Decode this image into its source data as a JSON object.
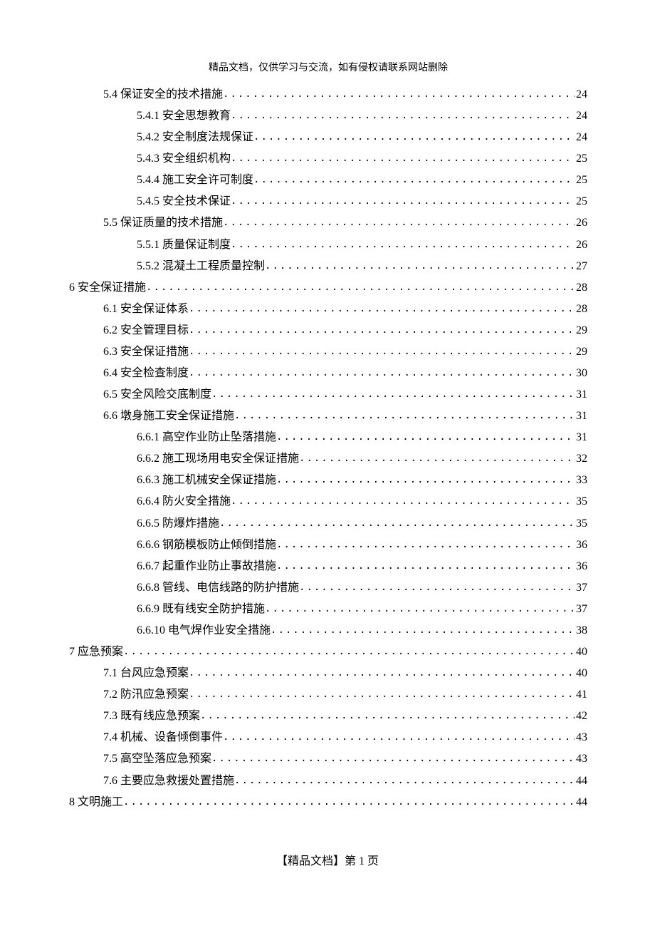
{
  "header_note": "精品文档，仅供学习与交流，如有侵权请联系网站删除",
  "toc": [
    {
      "indent": 1,
      "label": "5.4 保证安全的技术措施 ",
      "page": "24"
    },
    {
      "indent": 2,
      "label": "5.4.1 安全思想教育",
      "page": "24"
    },
    {
      "indent": 2,
      "label": "5.4.2 安全制度法规保证 ",
      "page": "24"
    },
    {
      "indent": 2,
      "label": "5.4.3 安全组织机构 ",
      "page": "25"
    },
    {
      "indent": 2,
      "label": "5.4.4 施工安全许可制度 ",
      "page": "25"
    },
    {
      "indent": 2,
      "label": "5.4.5 安全技术保证 ",
      "page": "25"
    },
    {
      "indent": 1,
      "label": "5.5 保证质量的技术措施",
      "page": "26"
    },
    {
      "indent": 2,
      "label": "5.5.1 质量保证制度",
      "page": "26"
    },
    {
      "indent": 2,
      "label": "5.5.2 混凝土工程质量控制 ",
      "page": "27"
    },
    {
      "indent": 0,
      "label": "6 安全保证措施 ",
      "page": "28"
    },
    {
      "indent": 1,
      "label": "6.1 安全保证体系 ",
      "page": "28"
    },
    {
      "indent": 1,
      "label": "6.2 安全管理目标 ",
      "page": "29"
    },
    {
      "indent": 1,
      "label": "6.3 安全保证措施 ",
      "page": "29"
    },
    {
      "indent": 1,
      "label": "6.4 安全检查制度 ",
      "page": "30"
    },
    {
      "indent": 1,
      "label": "6.5 安全风险交底制度 ",
      "page": "31"
    },
    {
      "indent": 1,
      "label": "6.6 墩身施工安全保证措施 ",
      "page": "31"
    },
    {
      "indent": 2,
      "label": "6.6.1 高空作业防止坠落措施",
      "page": "31"
    },
    {
      "indent": 2,
      "label": "6.6.2 施工现场用电安全保证措施",
      "page": "32"
    },
    {
      "indent": 2,
      "label": "6.6.3 施工机械安全保证措施",
      "page": "33"
    },
    {
      "indent": 2,
      "label": "6.6.4 防火安全措施",
      "page": "35"
    },
    {
      "indent": 2,
      "label": "6.6.5 防爆炸措施",
      "page": "35"
    },
    {
      "indent": 2,
      "label": "6.6.6 钢筋模板防止倾倒措施",
      "page": "36"
    },
    {
      "indent": 2,
      "label": "6.6.7 起重作业防止事故措施",
      "page": "36"
    },
    {
      "indent": 2,
      "label": "6.6.8 管线、电信线路的防护措施",
      "page": "37"
    },
    {
      "indent": 2,
      "label": "6.6.9 既有线安全防护措施",
      "page": "37"
    },
    {
      "indent": 2,
      "label": "6.6.10 电气焊作业安全措施",
      "page": "38"
    },
    {
      "indent": 0,
      "label": "7 应急预案 ",
      "page": "40"
    },
    {
      "indent": 1,
      "label": "7.1 台风应急预案 ",
      "page": "40"
    },
    {
      "indent": 1,
      "label": "7.2 防汛应急预案 ",
      "page": "41"
    },
    {
      "indent": 1,
      "label": "7.3 既有线应急预案 ",
      "page": "42"
    },
    {
      "indent": 1,
      "label": "7.4 机械、设备倾倒事件 ",
      "page": "43"
    },
    {
      "indent": 1,
      "label": "7.5 高空坠落应急预案 ",
      "page": "43"
    },
    {
      "indent": 1,
      "label": "7.6 主要应急救援处置措施 ",
      "page": "44"
    },
    {
      "indent": 0,
      "label": "8 文明施工 ",
      "page": "44"
    }
  ],
  "footer": {
    "prefix": "【精品文档】",
    "page_label": "第 1 页"
  }
}
